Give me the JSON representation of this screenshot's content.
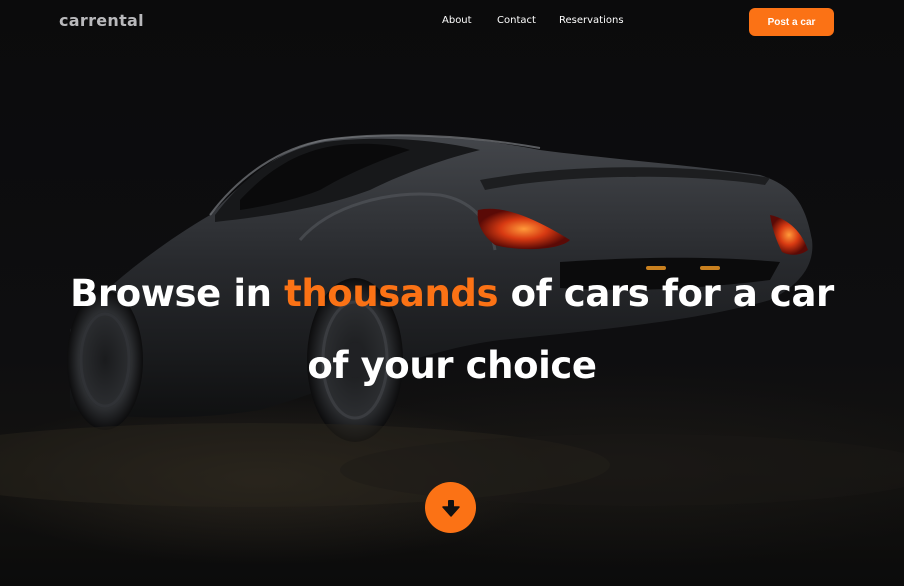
{
  "nav": {
    "logo": "carrental",
    "links": [
      {
        "label": "About"
      },
      {
        "label": "Contact"
      },
      {
        "label": "Reservations"
      }
    ],
    "cta_label": "Post a car"
  },
  "hero": {
    "headline_part1": "Browse in ",
    "headline_accent": "thousands",
    "headline_part2": " of cars for a car",
    "headline_line2": "of your choice",
    "scroll_icon": "arrow-down-icon",
    "image": "dark-sports-car-background"
  },
  "colors": {
    "accent": "#fb7215",
    "background": "#0c0c0d",
    "text": "#ffffff",
    "logo": "#b9b9bc"
  }
}
